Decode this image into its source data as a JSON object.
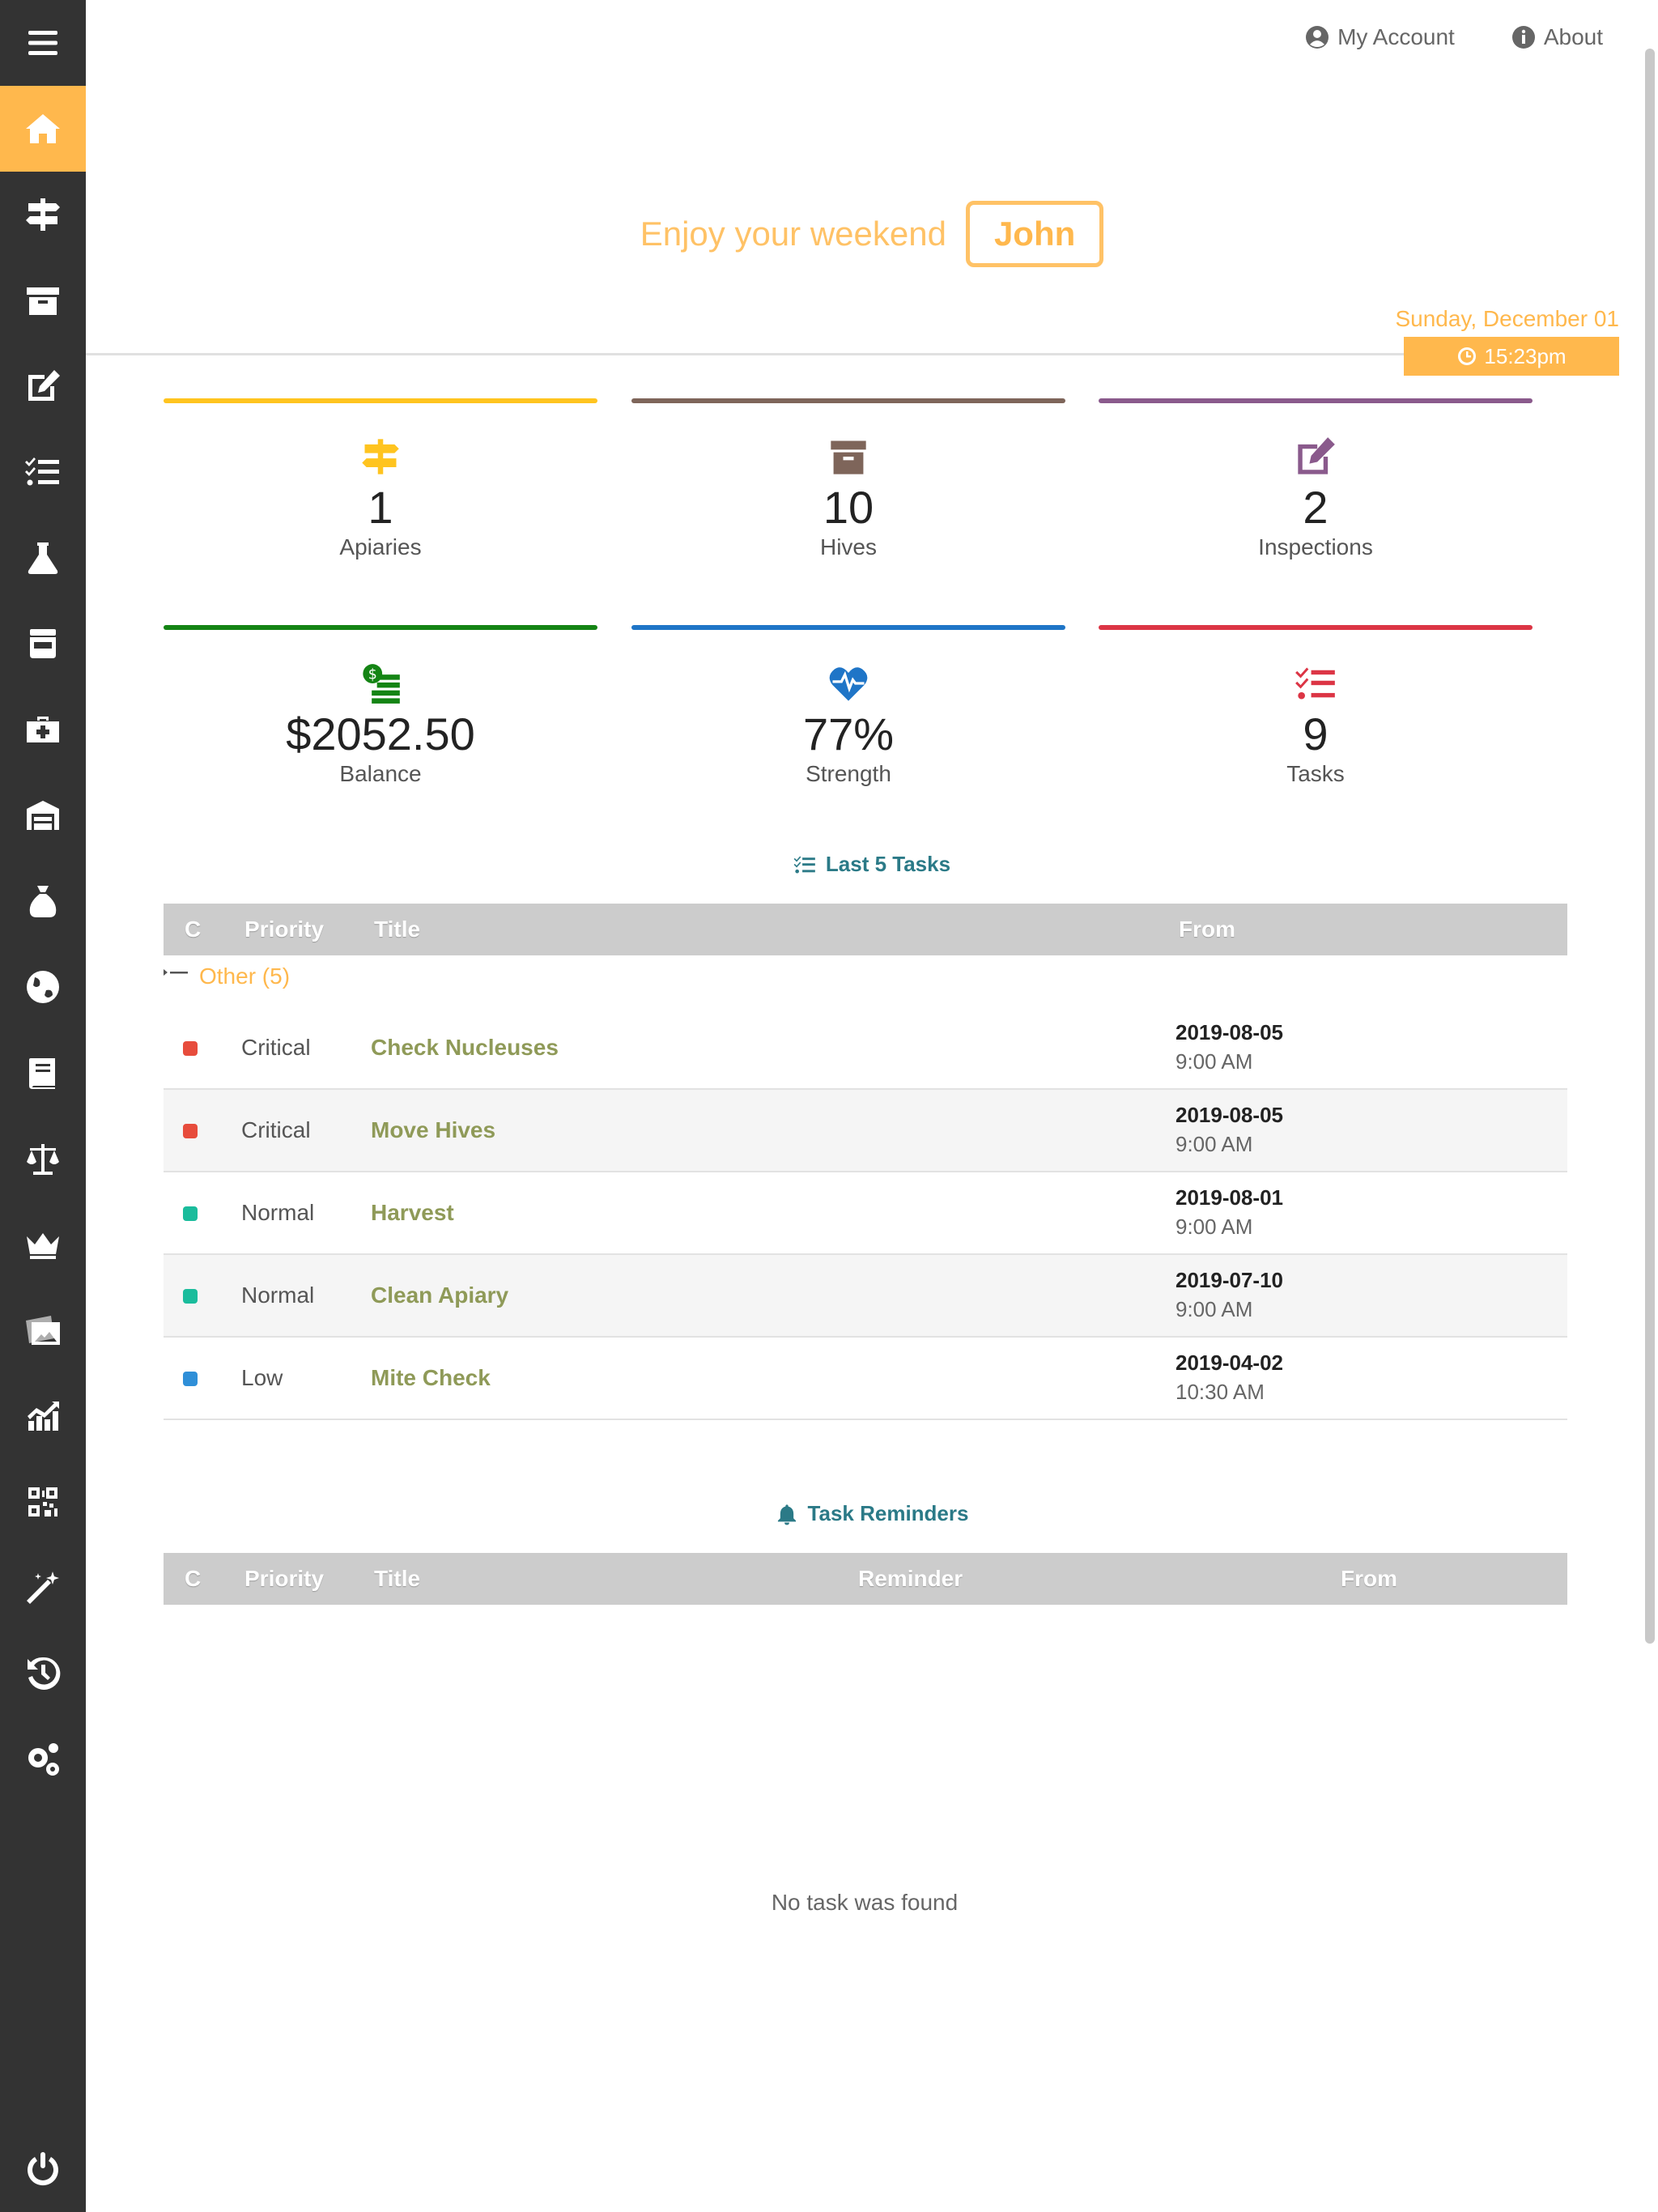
{
  "sidebar": {
    "items": [
      {
        "icon": "menu-icon"
      },
      {
        "icon": "home-icon",
        "active": true
      },
      {
        "icon": "signpost-icon"
      },
      {
        "icon": "archive-icon"
      },
      {
        "icon": "edit-icon"
      },
      {
        "icon": "tasks-icon"
      },
      {
        "icon": "flask-icon"
      },
      {
        "icon": "box-icon"
      },
      {
        "icon": "medkit-icon"
      },
      {
        "icon": "warehouse-icon"
      },
      {
        "icon": "money-bag-icon"
      },
      {
        "icon": "globe-icon"
      },
      {
        "icon": "book-icon"
      },
      {
        "icon": "balance-scale-icon"
      },
      {
        "icon": "crown-icon"
      },
      {
        "icon": "images-icon"
      },
      {
        "icon": "chart-icon"
      },
      {
        "icon": "qr-code-icon"
      },
      {
        "icon": "magic-wand-icon"
      },
      {
        "icon": "history-icon"
      },
      {
        "icon": "gears-icon"
      },
      {
        "icon": "power-icon"
      }
    ]
  },
  "header": {
    "my_account": "My Account",
    "about": "About",
    "greeting": "Enjoy your weekend",
    "name": "John",
    "date": "Sunday, December 01",
    "time": "15:23pm"
  },
  "stats": [
    {
      "value": "1",
      "label": "Apiaries",
      "color": "#ffc41f",
      "icon": "signpost-icon"
    },
    {
      "value": "10",
      "label": "Hives",
      "color": "#7e655a",
      "icon": "archive-icon"
    },
    {
      "value": "2",
      "label": "Inspections",
      "color": "#8a5a8c",
      "icon": "edit-icon"
    },
    {
      "value": "$2052.50",
      "label": "Balance",
      "color": "#148414",
      "icon": "money-icon"
    },
    {
      "value": "77%",
      "label": "Strength",
      "color": "#1f75c7",
      "icon": "heartbeat-icon"
    },
    {
      "value": "9",
      "label": "Tasks",
      "color": "#dc3545",
      "icon": "tasks-icon"
    }
  ],
  "last_tasks": {
    "title": "Last 5 Tasks",
    "columns": {
      "c": "C",
      "priority": "Priority",
      "title": "Title",
      "from": "From"
    },
    "group": "Other (5)",
    "rows": [
      {
        "color": "#e74c3c",
        "priority": "Critical",
        "title": "Check Nucleuses",
        "date": "2019-08-05",
        "time": "9:00 AM"
      },
      {
        "color": "#e74c3c",
        "priority": "Critical",
        "title": "Move Hives",
        "date": "2019-08-05",
        "time": "9:00 AM"
      },
      {
        "color": "#1abc9c",
        "priority": "Normal",
        "title": "Harvest",
        "date": "2019-08-01",
        "time": "9:00 AM"
      },
      {
        "color": "#1abc9c",
        "priority": "Normal",
        "title": "Clean Apiary",
        "date": "2019-07-10",
        "time": "9:00 AM"
      },
      {
        "color": "#2f8fd8",
        "priority": "Low",
        "title": "Mite Check",
        "date": "2019-04-02",
        "time": "10:30 AM"
      }
    ]
  },
  "reminders": {
    "title": "Task Reminders",
    "columns": {
      "c": "C",
      "priority": "Priority",
      "title": "Title",
      "reminder": "Reminder",
      "from": "From"
    },
    "empty": "No task was found"
  }
}
